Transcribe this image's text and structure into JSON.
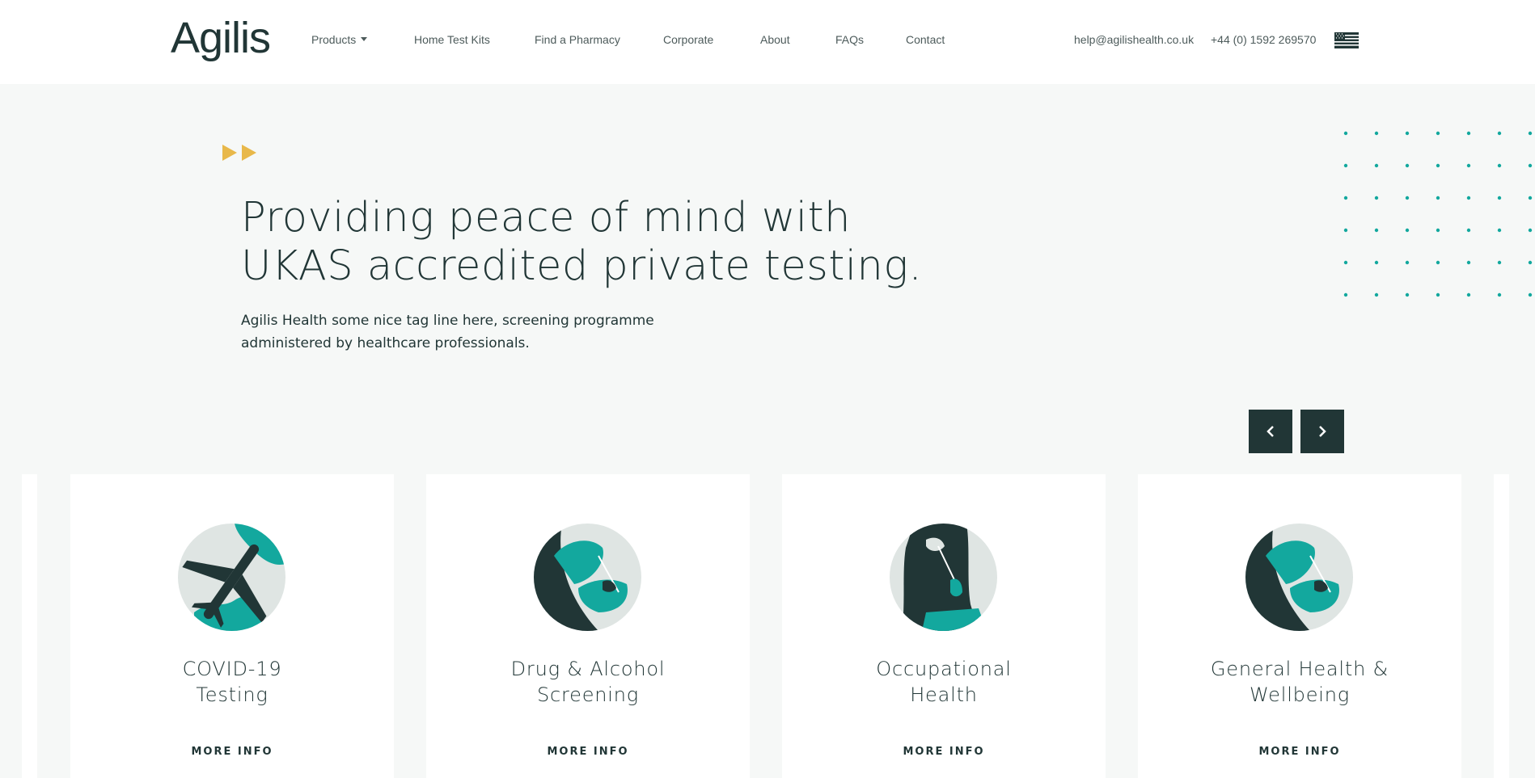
{
  "header": {
    "logo": "Agilis",
    "nav": [
      {
        "label": "Products",
        "has_dropdown": true
      },
      {
        "label": "Home Test Kits"
      },
      {
        "label": "Find a Pharmacy"
      },
      {
        "label": "Corporate"
      },
      {
        "label": "About"
      },
      {
        "label": "FAQs"
      },
      {
        "label": "Contact"
      }
    ],
    "email": "help@agilishealth.co.uk",
    "phone": "+44 (0) 1592 269570",
    "flag_icon": "us-flag-icon"
  },
  "hero": {
    "title_line1": "Providing peace of mind with",
    "title_line2": "UKAS accredited private testing.",
    "subtitle_line1": "Agilis Health some nice tag line here, screening programme",
    "subtitle_line2": "administered by healthcare professionals."
  },
  "carousel": {
    "prev_icon": "chevron-left-icon",
    "next_icon": "chevron-right-icon"
  },
  "cards": [
    {
      "title_line1": "COVID-19",
      "title_line2": "Testing",
      "link": "MORE INFO",
      "icon": "airplane-icon"
    },
    {
      "title_line1": "Drug & Alcohol",
      "title_line2": "Screening",
      "link": "MORE INFO",
      "icon": "swab-test-icon"
    },
    {
      "title_line1": "Occupational",
      "title_line2": "Health",
      "link": "MORE INFO",
      "icon": "throat-swab-icon"
    },
    {
      "title_line1": "General Health &",
      "title_line2": "Wellbeing",
      "link": "MORE INFO",
      "icon": "swab-test-icon"
    }
  ],
  "colors": {
    "primary": "#213636",
    "accent_teal": "#13a89e",
    "accent_gold": "#e8b84a",
    "background": "#f6f8f7",
    "card_bg": "#ffffff"
  }
}
